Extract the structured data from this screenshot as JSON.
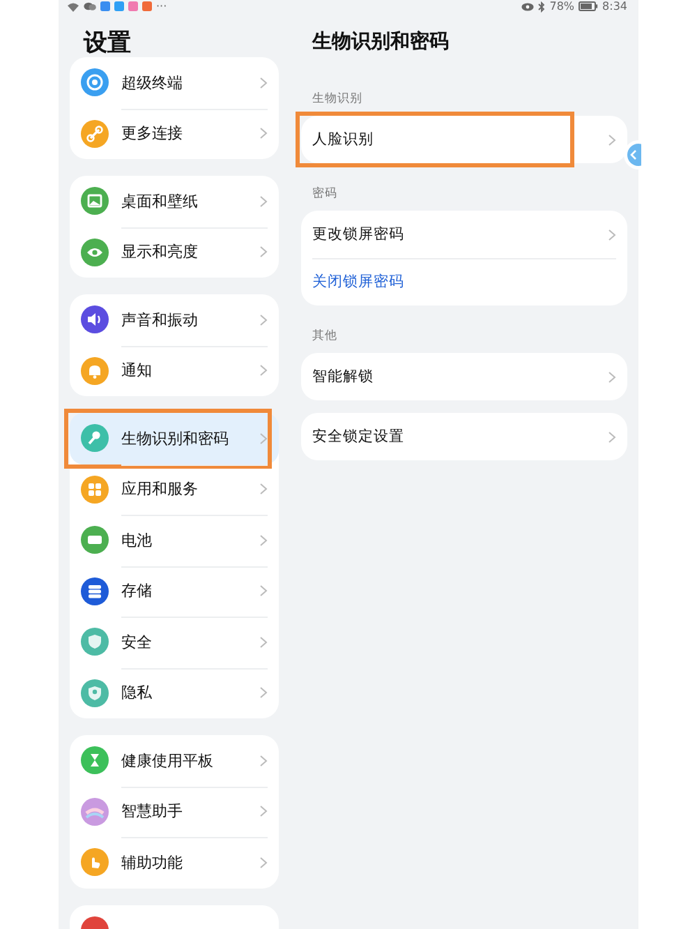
{
  "status_bar": {
    "more": "···",
    "battery_text": "78%",
    "time": "8:34"
  },
  "sidebar": {
    "title": "设置",
    "groups": [
      {
        "items": [
          {
            "label": "超级终端",
            "color": "#3a9ff0",
            "selected": false,
            "highlighted": false
          },
          {
            "label": "更多连接",
            "color": "#f5a623",
            "selected": false,
            "highlighted": false
          }
        ]
      },
      {
        "items": [
          {
            "label": "桌面和壁纸",
            "color": "#4caf50",
            "selected": false,
            "highlighted": false
          },
          {
            "label": "显示和亮度",
            "color": "#4caf50",
            "selected": false,
            "highlighted": false
          }
        ]
      },
      {
        "items": [
          {
            "label": "声音和振动",
            "color": "#5b4de0",
            "selected": false,
            "highlighted": false
          },
          {
            "label": "通知",
            "color": "#f5a623",
            "selected": false,
            "highlighted": false
          }
        ]
      },
      {
        "items": [
          {
            "label": "生物识别和密码",
            "color": "#3dbfa8",
            "selected": true,
            "highlighted": true
          },
          {
            "label": "应用和服务",
            "color": "#f5a623",
            "selected": false,
            "highlighted": false
          },
          {
            "label": "电池",
            "color": "#4caf50",
            "selected": false,
            "highlighted": false
          },
          {
            "label": "存储",
            "color": "#1e5bd8",
            "selected": false,
            "highlighted": false
          },
          {
            "label": "安全",
            "color": "#4dbba5",
            "selected": false,
            "highlighted": false
          },
          {
            "label": "隐私",
            "color": "#4dbba5",
            "selected": false,
            "highlighted": false
          }
        ]
      },
      {
        "items": [
          {
            "label": "健康使用平板",
            "color": "#3cc05a",
            "selected": false,
            "highlighted": false
          },
          {
            "label": "智慧助手",
            "color": "#c99ae0",
            "selected": false,
            "highlighted": false
          },
          {
            "label": "辅助功能",
            "color": "#f5a623",
            "selected": false,
            "highlighted": false
          }
        ]
      },
      {
        "items": [
          {
            "color": "#e0443c"
          }
        ]
      }
    ]
  },
  "detail": {
    "title": "生物识别和密码",
    "sections": [
      {
        "heading": "生物识别",
        "cards": [
          {
            "items": [
              {
                "label": "人脸识别",
                "kind": "nav",
                "highlighted": true
              }
            ]
          }
        ]
      },
      {
        "heading": "密码",
        "cards": [
          {
            "items": [
              {
                "label": "更改锁屏密码",
                "kind": "nav",
                "highlighted": false
              },
              {
                "label": "关闭锁屏密码",
                "kind": "action",
                "highlighted": false
              }
            ]
          }
        ]
      },
      {
        "heading": "其他",
        "cards": [
          {
            "items": [
              {
                "label": "智能解锁",
                "kind": "nav",
                "highlighted": false
              }
            ]
          },
          {
            "items": [
              {
                "label": "安全锁定设置",
                "kind": "nav",
                "highlighted": false
              }
            ]
          }
        ]
      }
    ]
  }
}
